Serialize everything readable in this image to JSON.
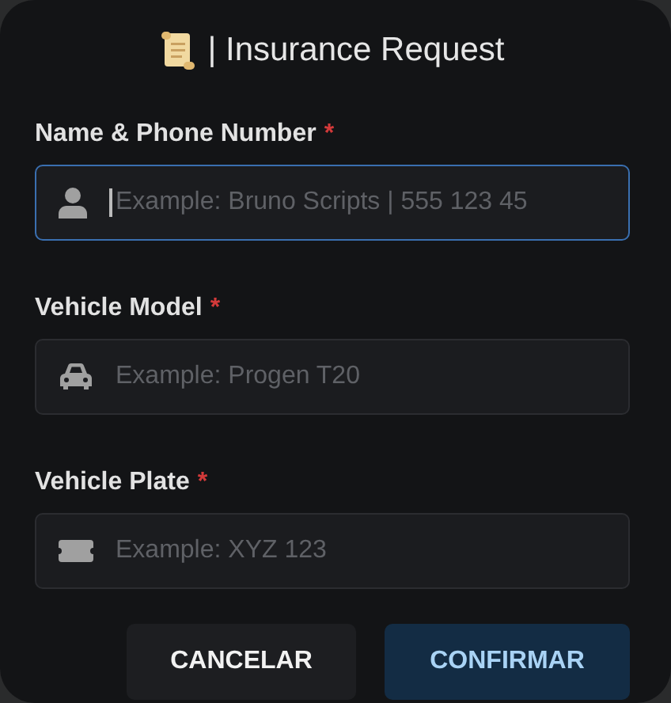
{
  "dialog": {
    "title": "| Insurance Request"
  },
  "fields": [
    {
      "kind": "person",
      "label": "Name & Phone Number",
      "required_mark": "*",
      "placeholder": "Example: Bruno Scripts | 555 123 45",
      "focused": true
    },
    {
      "kind": "car",
      "label": "Vehicle Model",
      "required_mark": "*",
      "placeholder": "Example: Progen T20",
      "focused": false
    },
    {
      "kind": "ticket",
      "label": "Vehicle Plate",
      "required_mark": "*",
      "placeholder": "Example: XYZ 123",
      "focused": false
    }
  ],
  "buttons": [
    {
      "label": "CANCELAR",
      "kind": "secondary"
    },
    {
      "label": "CONFIRMAR",
      "kind": "primary"
    }
  ]
}
